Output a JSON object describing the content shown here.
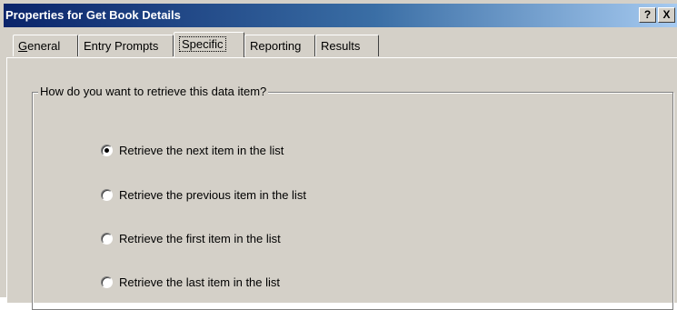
{
  "window": {
    "title": "Properties for Get Book Details",
    "help_label": "?",
    "close_label": "X"
  },
  "tabs": [
    {
      "label_prefix": "",
      "accel": "G",
      "label_rest": "eneral"
    },
    {
      "label": "Entry Prompts"
    },
    {
      "label": "Specific",
      "active": true
    },
    {
      "label": "Reporting"
    },
    {
      "label": "Results"
    }
  ],
  "group": {
    "label": "How do you want to retrieve this data item?"
  },
  "options": [
    {
      "label": "Retrieve the next item in the list",
      "selected": true
    },
    {
      "label": "Retrieve the previous item in the list",
      "selected": false
    },
    {
      "label": "Retrieve the first item in the list",
      "selected": false
    },
    {
      "label": "Retrieve the last item in the list",
      "selected": false
    }
  ]
}
